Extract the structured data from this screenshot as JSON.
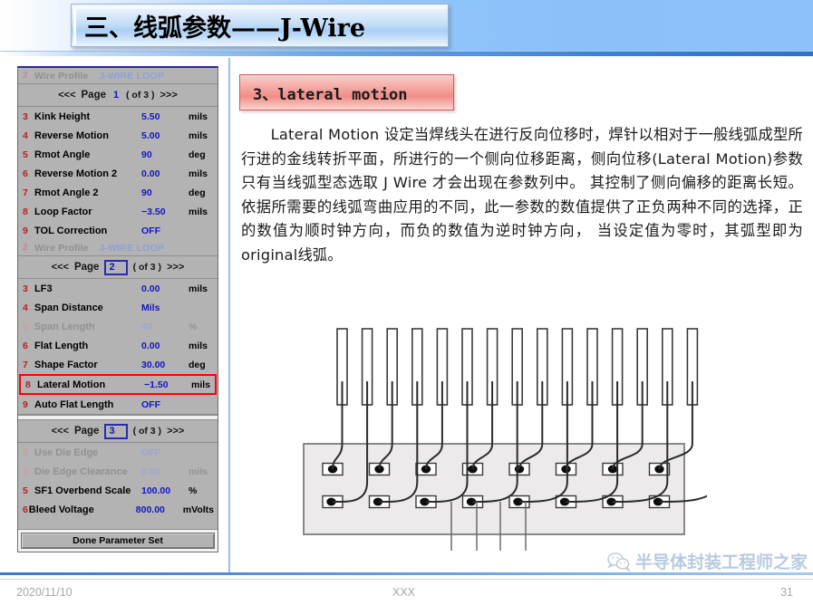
{
  "header": {
    "title": "三、线弧参数——J-Wire"
  },
  "param_panel": {
    "sections": [
      {
        "header": {
          "index": "2",
          "label": "Wire Profile",
          "value": "J-WIRE LOOP"
        },
        "pagebar": {
          "prev": "<<<",
          "word": "Page",
          "num": "1",
          "of": "( of 3 )",
          "next": ">>>",
          "boxed": false
        },
        "rows": [
          {
            "n": "3",
            "name": "Kink Height",
            "value": "5.50",
            "unit": "mils",
            "dim": false,
            "highlight": false
          },
          {
            "n": "4",
            "name": "Reverse Motion",
            "value": "5.00",
            "unit": "mils",
            "dim": false,
            "highlight": false
          },
          {
            "n": "5",
            "name": "Rmot Angle",
            "value": "90",
            "unit": "deg",
            "dim": false,
            "highlight": false
          },
          {
            "n": "6",
            "name": "Reverse Motion 2",
            "value": "0.00",
            "unit": "mils",
            "dim": false,
            "highlight": false
          },
          {
            "n": "7",
            "name": "Rmot Angle 2",
            "value": "90",
            "unit": "deg",
            "dim": false,
            "highlight": false
          },
          {
            "n": "8",
            "name": "Loop Factor",
            "value": "−3.50",
            "unit": "mils",
            "dim": false,
            "highlight": false
          },
          {
            "n": "9",
            "name": "TOL Correction",
            "value": "OFF",
            "unit": "",
            "dim": false,
            "highlight": false
          }
        ]
      },
      {
        "header": {
          "index": "2",
          "label": "Wire Profile",
          "value": "J-WIRE LOOP"
        },
        "pagebar": {
          "prev": "<<<",
          "word": "Page",
          "num": "2",
          "of": "( of 3 )",
          "next": ">>>",
          "boxed": true
        },
        "rows": [
          {
            "n": "3",
            "name": "LF3",
            "value": "0.00",
            "unit": "mils",
            "dim": false,
            "highlight": false
          },
          {
            "n": "4",
            "name": "Span Distance",
            "value": "Mils",
            "unit": "",
            "dim": false,
            "highlight": false
          },
          {
            "n": "5",
            "name": "Span Length",
            "value": "40",
            "unit": "%",
            "dim": true,
            "highlight": false
          },
          {
            "n": "6",
            "name": "Flat Length",
            "value": "0.00",
            "unit": "mils",
            "dim": false,
            "highlight": false
          },
          {
            "n": "7",
            "name": "Shape Factor",
            "value": "30.00",
            "unit": "deg",
            "dim": false,
            "highlight": false
          },
          {
            "n": "8",
            "name": "Lateral Motion",
            "value": "−1.50",
            "unit": "mils",
            "dim": false,
            "highlight": true
          },
          {
            "n": "9",
            "name": "Auto Flat Length",
            "value": "OFF",
            "unit": "",
            "dim": false,
            "highlight": false
          }
        ]
      },
      {
        "header": null,
        "pagebar": {
          "prev": "<<<",
          "word": "Page",
          "num": "3",
          "of": "( of 3 )",
          "next": ">>>",
          "boxed": true
        },
        "rows": [
          {
            "n": "3",
            "name": "Use Die Edge",
            "value": "OFF",
            "unit": "",
            "dim": true,
            "highlight": false
          },
          {
            "n": "4",
            "name": "Die Edge Clearance",
            "value": "0.00",
            "unit": "mils",
            "dim": true,
            "highlight": false
          },
          {
            "n": "5",
            "name": "SF1 Overbend Scale",
            "value": "100.00",
            "unit": "%",
            "dim": false,
            "highlight": false
          },
          {
            "n": "6",
            "name": "Bleed Voltage",
            "value": "800.00",
            "unit": "mVolts",
            "dim": false,
            "highlight": false
          }
        ]
      }
    ],
    "done_button": "Done Parameter Set"
  },
  "content": {
    "section_title": "3、lateral motion",
    "body": "Lateral Motion 设定当焊线头在进行反向位移时，焊针以相对于一般线弧成型所行进的金线转折平面，所进行的一个侧向位移距离，侧向位移(Lateral Motion)参数只有当线弧型态选取 J Wire 才会出现在参数列中。 其控制了侧向偏移的距离长短。 依据所需要的线弧弯曲应用的不同，此一参数的数值提供了正负两种不同的选择，正的数值为顺时钟方向，而负的数值为逆时钟方向， 当设定值为零时，其弧型即为original线弧。"
  },
  "diagram": {
    "type": "wire-bonding-leadframe",
    "lead_count": 16,
    "pad_pairs": 8,
    "note": "lead fingers above, die/substrate block below with two rows of bond pads and J-wire loops"
  },
  "watermark": {
    "text": "半导体封装工程师之家",
    "icon": "wechat-icon"
  },
  "footer": {
    "date": "2020/11/10",
    "center": "XXX",
    "page_number": "31"
  }
}
